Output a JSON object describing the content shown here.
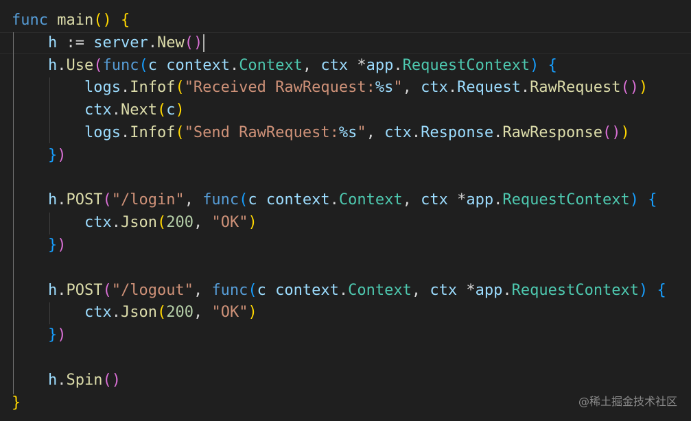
{
  "editor": {
    "theme": "dark",
    "background": "#1f1f1f",
    "lines": [
      [
        [
          "func",
          "kw"
        ],
        [
          " ",
          "plain"
        ],
        [
          "main",
          "fn"
        ],
        [
          "(",
          "p1"
        ],
        [
          ")",
          "p1"
        ],
        [
          " ",
          "plain"
        ],
        [
          "{",
          "p1"
        ]
      ],
      [
        [
          "    ",
          "plain"
        ],
        [
          "h",
          "var"
        ],
        [
          " := ",
          "op"
        ],
        [
          "server",
          "var"
        ],
        [
          ".",
          "plain"
        ],
        [
          "New",
          "fn"
        ],
        [
          "(",
          "p2"
        ],
        [
          ")",
          "p2"
        ]
      ],
      [
        [
          "    ",
          "plain"
        ],
        [
          "h",
          "var"
        ],
        [
          ".",
          "plain"
        ],
        [
          "Use",
          "fn"
        ],
        [
          "(",
          "p2"
        ],
        [
          "func",
          "kw"
        ],
        [
          "(",
          "p3"
        ],
        [
          "c",
          "var"
        ],
        [
          " ",
          "plain"
        ],
        [
          "context",
          "var"
        ],
        [
          ".",
          "plain"
        ],
        [
          "Context",
          "typ"
        ],
        [
          ", ",
          "plain"
        ],
        [
          "ctx",
          "var"
        ],
        [
          " *",
          "op"
        ],
        [
          "app",
          "var"
        ],
        [
          ".",
          "plain"
        ],
        [
          "RequestContext",
          "typ"
        ],
        [
          ")",
          "p3"
        ],
        [
          " ",
          "plain"
        ],
        [
          "{",
          "p3"
        ]
      ],
      [
        [
          "        ",
          "plain"
        ],
        [
          "logs",
          "var"
        ],
        [
          ".",
          "plain"
        ],
        [
          "Infof",
          "fn"
        ],
        [
          "(",
          "p1"
        ],
        [
          "\"Received RawRequest:",
          "str"
        ],
        [
          "%s",
          "fmt"
        ],
        [
          "\"",
          "str"
        ],
        [
          ", ",
          "plain"
        ],
        [
          "ctx",
          "var"
        ],
        [
          ".",
          "plain"
        ],
        [
          "Request",
          "var"
        ],
        [
          ".",
          "plain"
        ],
        [
          "RawRequest",
          "fn"
        ],
        [
          "(",
          "p2"
        ],
        [
          ")",
          "p2"
        ],
        [
          ")",
          "p1"
        ]
      ],
      [
        [
          "        ",
          "plain"
        ],
        [
          "ctx",
          "var"
        ],
        [
          ".",
          "plain"
        ],
        [
          "Next",
          "fn"
        ],
        [
          "(",
          "p1"
        ],
        [
          "c",
          "var"
        ],
        [
          ")",
          "p1"
        ]
      ],
      [
        [
          "        ",
          "plain"
        ],
        [
          "logs",
          "var"
        ],
        [
          ".",
          "plain"
        ],
        [
          "Infof",
          "fn"
        ],
        [
          "(",
          "p1"
        ],
        [
          "\"Send RawRequest:",
          "str"
        ],
        [
          "%s",
          "fmt"
        ],
        [
          "\"",
          "str"
        ],
        [
          ", ",
          "plain"
        ],
        [
          "ctx",
          "var"
        ],
        [
          ".",
          "plain"
        ],
        [
          "Response",
          "var"
        ],
        [
          ".",
          "plain"
        ],
        [
          "RawResponse",
          "fn"
        ],
        [
          "(",
          "p2"
        ],
        [
          ")",
          "p2"
        ],
        [
          ")",
          "p1"
        ]
      ],
      [
        [
          "    ",
          "plain"
        ],
        [
          "}",
          "p3"
        ],
        [
          ")",
          "p2"
        ]
      ],
      [],
      [
        [
          "    ",
          "plain"
        ],
        [
          "h",
          "var"
        ],
        [
          ".",
          "plain"
        ],
        [
          "POST",
          "fn"
        ],
        [
          "(",
          "p2"
        ],
        [
          "\"/login\"",
          "str"
        ],
        [
          ", ",
          "plain"
        ],
        [
          "func",
          "kw"
        ],
        [
          "(",
          "p3"
        ],
        [
          "c",
          "var"
        ],
        [
          " ",
          "plain"
        ],
        [
          "context",
          "var"
        ],
        [
          ".",
          "plain"
        ],
        [
          "Context",
          "typ"
        ],
        [
          ", ",
          "plain"
        ],
        [
          "ctx",
          "var"
        ],
        [
          " *",
          "op"
        ],
        [
          "app",
          "var"
        ],
        [
          ".",
          "plain"
        ],
        [
          "RequestContext",
          "typ"
        ],
        [
          ")",
          "p3"
        ],
        [
          " ",
          "plain"
        ],
        [
          "{",
          "p3"
        ]
      ],
      [
        [
          "        ",
          "plain"
        ],
        [
          "ctx",
          "var"
        ],
        [
          ".",
          "plain"
        ],
        [
          "Json",
          "fn"
        ],
        [
          "(",
          "p1"
        ],
        [
          "200",
          "num"
        ],
        [
          ", ",
          "plain"
        ],
        [
          "\"OK\"",
          "str"
        ],
        [
          ")",
          "p1"
        ]
      ],
      [
        [
          "    ",
          "plain"
        ],
        [
          "}",
          "p3"
        ],
        [
          ")",
          "p2"
        ]
      ],
      [],
      [
        [
          "    ",
          "plain"
        ],
        [
          "h",
          "var"
        ],
        [
          ".",
          "plain"
        ],
        [
          "POST",
          "fn"
        ],
        [
          "(",
          "p2"
        ],
        [
          "\"/logout\"",
          "str"
        ],
        [
          ", ",
          "plain"
        ],
        [
          "func",
          "kw"
        ],
        [
          "(",
          "p3"
        ],
        [
          "c",
          "var"
        ],
        [
          " ",
          "plain"
        ],
        [
          "context",
          "var"
        ],
        [
          ".",
          "plain"
        ],
        [
          "Context",
          "typ"
        ],
        [
          ", ",
          "plain"
        ],
        [
          "ctx",
          "var"
        ],
        [
          " *",
          "op"
        ],
        [
          "app",
          "var"
        ],
        [
          ".",
          "plain"
        ],
        [
          "RequestContext",
          "typ"
        ],
        [
          ")",
          "p3"
        ],
        [
          " ",
          "plain"
        ],
        [
          "{",
          "p3"
        ]
      ],
      [
        [
          "        ",
          "plain"
        ],
        [
          "ctx",
          "var"
        ],
        [
          ".",
          "plain"
        ],
        [
          "Json",
          "fn"
        ],
        [
          "(",
          "p1"
        ],
        [
          "200",
          "num"
        ],
        [
          ", ",
          "plain"
        ],
        [
          "\"OK\"",
          "str"
        ],
        [
          ")",
          "p1"
        ]
      ],
      [
        [
          "    ",
          "plain"
        ],
        [
          "}",
          "p3"
        ],
        [
          ")",
          "p2"
        ]
      ],
      [],
      [
        [
          "    ",
          "plain"
        ],
        [
          "h",
          "var"
        ],
        [
          ".",
          "plain"
        ],
        [
          "Spin",
          "fn"
        ],
        [
          "(",
          "p2"
        ],
        [
          ")",
          "p2"
        ]
      ],
      [
        [
          "}",
          "p1"
        ]
      ]
    ],
    "cursor_line": 2,
    "cursor_column": 19
  },
  "watermark": "@稀土掘金技术社区",
  "colors": {
    "keyword": "#569cd6",
    "function": "#dcdcaa",
    "variable": "#9cdcfe",
    "type": "#4ec9b0",
    "string": "#ce9178",
    "number": "#b5cea8",
    "bracket_level1": "#ffd700",
    "bracket_level2": "#da70d6",
    "bracket_level3": "#179fff"
  }
}
